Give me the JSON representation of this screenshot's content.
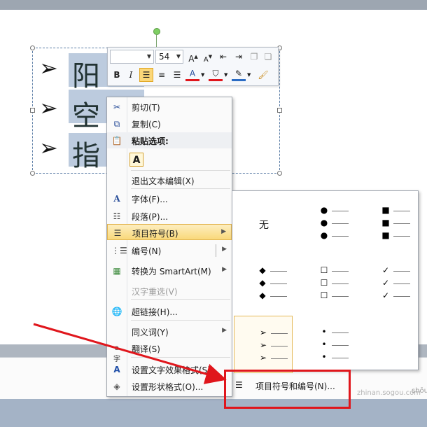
{
  "slide": {
    "bullets": [
      {
        "marker": "➢",
        "text": "阳"
      },
      {
        "marker": "➢",
        "text": "空"
      },
      {
        "marker": "➢",
        "text": "指"
      }
    ]
  },
  "mini_toolbar": {
    "font_name": "",
    "font_size": "54",
    "row1_buttons": [
      "A↑",
      "A↓",
      "decrease-indent",
      "increase-indent",
      "shape-style"
    ],
    "row2_buttons": [
      "B",
      "I",
      "align-left",
      "center",
      "align-right",
      "A",
      "fill",
      "outline",
      "format-painter"
    ],
    "bold": "B",
    "italic": "I",
    "grow_font": "A",
    "shrink_font": "A",
    "font_color_letter": "A",
    "active_alignment": "align-left"
  },
  "context_menu": {
    "items": [
      {
        "label": "剪切(T)",
        "icon": "scissors-icon"
      },
      {
        "label": "复制(C)",
        "icon": "copy-icon"
      },
      {
        "label": "粘贴选项:",
        "icon": "paste-icon",
        "header": true
      },
      {
        "label": "退出文本编辑(X)",
        "icon": ""
      },
      {
        "label": "字体(F)...",
        "icon": "font-icon"
      },
      {
        "label": "段落(P)...",
        "icon": "paragraph-icon"
      },
      {
        "label": "项目符号(B)",
        "icon": "bullets-icon",
        "submenu": true,
        "hover": true
      },
      {
        "label": "编号(N)",
        "icon": "numbering-icon",
        "submenu": true
      },
      {
        "label": "转换为 SmartArt(M)",
        "icon": "smartart-icon",
        "submenu": true
      },
      {
        "label": "汉字重选(V)",
        "icon": "",
        "disabled": true
      },
      {
        "label": "超链接(H)...",
        "icon": "hyperlink-icon"
      },
      {
        "label": "同义词(Y)",
        "icon": "",
        "submenu": true
      },
      {
        "label": "翻译(S)",
        "icon": "translate-icon"
      },
      {
        "label": "设置文字效果格式(S)...",
        "icon": "text-effects-icon"
      },
      {
        "label": "设置形状格式(O)...",
        "icon": "shape-format-icon"
      }
    ],
    "paste_option": "A"
  },
  "bullet_gallery": {
    "none_label": "无",
    "cells": [
      {
        "name": "none"
      },
      {
        "name": "filled-round",
        "symbol": "●"
      },
      {
        "name": "filled-square",
        "symbol": "■"
      },
      {
        "name": "diamond",
        "symbol": "◆"
      },
      {
        "name": "hollow-square",
        "symbol": "☐"
      },
      {
        "name": "check",
        "symbol": "✓"
      },
      {
        "name": "arrow",
        "symbol": "➢",
        "selected": true
      },
      {
        "name": "small-dot",
        "symbol": "•"
      }
    ],
    "footer_label": "项目符号和编号(N)..."
  },
  "watermark": "shōuchē",
  "watermark_site": "zhinan.sogou.com",
  "colors": {
    "highlight": "#f9d87a",
    "annotation_red": "#e0161c",
    "selection": "#bccbde"
  }
}
